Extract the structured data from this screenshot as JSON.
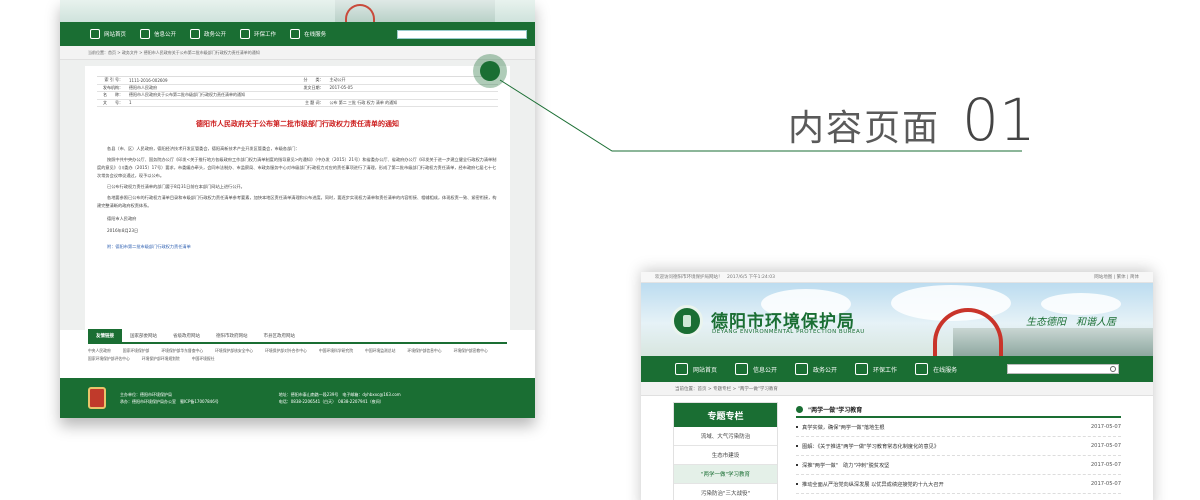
{
  "left_card": {
    "nav": [
      "网站首页",
      "信息公开",
      "政务公开",
      "环保工作",
      "在线服务"
    ],
    "crumb": "当前位置：首页 > 政务文件 > 德阳市人民政府关于公布第二批市级部门行政权力责任清单的通知",
    "meta": [
      {
        "k": "索 引 号：",
        "v": "1111-2016-002609"
      },
      {
        "k": "分　　类：",
        "v": "主动公开"
      },
      {
        "k": "发布机构：",
        "v": "德阳市人民政府"
      },
      {
        "k": "发文日期：",
        "v": "2017-05-05"
      },
      {
        "k": "名　　称：",
        "v": "德阳市人民政府关于公布第二批市级部门行政权力责任清单的通知",
        "full": true
      },
      {
        "k": "文　　号：",
        "v": "1"
      },
      {
        "k": "主 题 词：",
        "v": "公布 第二 三批 行政 权力 清单 的通知"
      }
    ],
    "title": "德阳市人民政府关于公布第二批市级部门行政权力责任清单的通知",
    "paragraphs": [
      "各县（市、区）人民政府，德阳经济技术开发区管委会，德阳高新技术产业开发区管委会，市级各部门：",
      "按照中共中央办公厅、国务院办公厅《印发<关于推行地方各级政府工作部门权力清单制度的指导意见>的通知》（中办发〔2015〕21号）和省委办公厅、省政府办公厅《印发关于进一步建立健全行政权力清单制度的意见》（川委办〔2015〕17号）要求，市委编办牵头，会同市法制办、市监察局、市政务服务中心对市级部门行政权力对应的责任事项进行了清理，形成了第二批市级部门行政权力责任清单，经市政府七届七十七次常务会议审议通过，现予以公布。",
      "已公布行政权力责任清单的部门要于8月31日前在本部门网站上进行公开。",
      "各地要参照已公布的行政权力清单目录和市级部门行政权力责任清单参考要素，加快本地区责任清单清理和公布进度。同时，要逐步实现权力清单和责任清单的内容衔接、相辅相成，体现权责一致、紧密衔接，构建完整清晰的政府权责体系。"
    ],
    "sign_org": "德阳市人民政府",
    "sign_date": "2016年8月23日",
    "attachment": "附：德阳市第二批市级部门行政权力责任清单",
    "link_tabs": [
      "友情链接",
      "国家部委网站",
      "省级政府网站",
      "德阳市政府网站",
      "市县区政府网站"
    ],
    "links": [
      "中央人民政府",
      "国家环境保护部",
      "环境保护部华东督查中心",
      "环境保护部核安全中心",
      "环境保护部对外合作中心",
      "中国环境科学研究院",
      "中国环境监测总站",
      "环境保护部信息中心",
      "环境保护部宣教中心",
      "国家环境保护部评估中心",
      "环境保护部环境规划院",
      "中国环境报社"
    ],
    "footer": [
      "主办单位：德阳市环境保护局",
      "承办：德阳市环境保护局办公室　蜀ICP备17007846号",
      "地址：德阳市泰山南路一段239号　电子邮箱：dyhbxxc@163.com",
      "电话：0838-2206541（白天）　0838-2207941（夜间）"
    ]
  },
  "callout": {
    "cn": "内容页面",
    "num": "01"
  },
  "right_card": {
    "topbar_left": "欢迎访问德阳市环境保护局网站！　2017/6/5 下午1:24:03",
    "topbar_right": "网站地图 | 繁体 | 简体",
    "site_name": "德阳市环境保护局",
    "site_en": "DEYANG ENVIRONMENTAL PROTECTION BUREAU",
    "slogan": "生态德阳　和谐人居",
    "nav": [
      "网站首页",
      "信息公开",
      "政务公开",
      "环保工作",
      "在线服务"
    ],
    "crumb": "当前位置：首页 > 专题专栏 > \"两学一做\"学习教育",
    "side_title": "专题专栏",
    "side_items": [
      "流域、大气污染防治",
      "生态市建设",
      "\"两学一做\"学习教育",
      "污染防治\"三大战役\""
    ],
    "side_active": 2,
    "content_title": "\"两学一做\"学习教育",
    "rows": [
      {
        "title": "真学实做，确保\"两学一做\"落地生根",
        "date": "2017-05-07"
      },
      {
        "title": "图解：《关于推进\"两学一做\"学习教育常态化制度化的意见》",
        "date": "2017-05-07"
      },
      {
        "title": "深推\"两学一做\"　助力\"冲刺\"脱贫攻坚",
        "date": "2017-05-07"
      },
      {
        "title": "推动全面从严治党向纵深发展 以优异成绩迎接党的十九大召开",
        "date": "2017-05-07"
      }
    ]
  },
  "colors": {
    "brand_green": "#1a6e33",
    "title_red": "#cc1a1a"
  }
}
